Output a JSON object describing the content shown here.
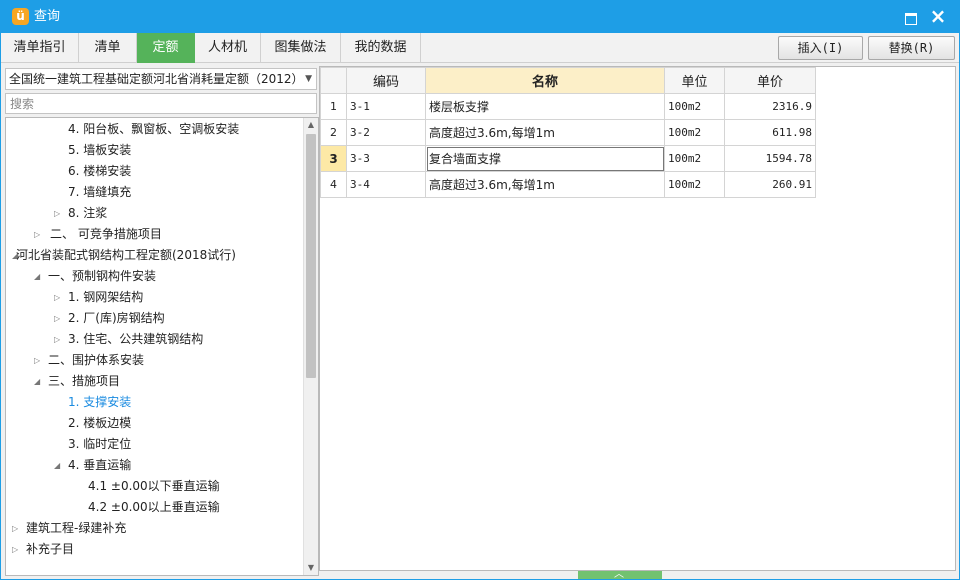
{
  "window": {
    "title": "查询",
    "app_icon": "app-logo-icon",
    "maximize_icon": "maximize-icon",
    "close_icon": "close-icon",
    "close_glyph": "×",
    "accent_color": "#1e9ee6"
  },
  "tabs": [
    {
      "label": "清单指引",
      "active": false
    },
    {
      "label": "清单",
      "active": false
    },
    {
      "label": "定额",
      "active": true
    },
    {
      "label": "人材机",
      "active": false
    },
    {
      "label": "图集做法",
      "active": false
    },
    {
      "label": "我的数据",
      "active": false
    }
  ],
  "active_tab_color": "#55b35a",
  "actions": {
    "insert_label": "插入(I)",
    "replace_label": "替换(R)"
  },
  "left": {
    "quota_library": "全国统一建筑工程基础定额河北省消耗量定额（2012）",
    "search_placeholder": "搜索",
    "tree": [
      {
        "label": "4. 阳台板、飘窗板、空调板安装",
        "toggle": ""
      },
      {
        "label": "5. 墙板安装",
        "toggle": ""
      },
      {
        "label": "6. 楼梯安装",
        "toggle": ""
      },
      {
        "label": "7. 墙缝填充",
        "toggle": ""
      },
      {
        "label": "8. 注浆",
        "toggle": "▷"
      },
      {
        "label": "二、 可竞争措施项目",
        "toggle": "▷"
      },
      {
        "label": "河北省装配式钢结构工程定额(2018试行)",
        "toggle": "◢"
      },
      {
        "label": "一、预制钢构件安装",
        "toggle": "◢"
      },
      {
        "label": "1. 钢网架结构",
        "toggle": "▷"
      },
      {
        "label": "2. 厂(库)房钢结构",
        "toggle": "▷"
      },
      {
        "label": "3. 住宅、公共建筑钢结构",
        "toggle": "▷"
      },
      {
        "label": "二、围护体系安装",
        "toggle": "▷"
      },
      {
        "label": "三、措施项目",
        "toggle": "◢"
      },
      {
        "label": "1. 支撑安装",
        "toggle": "",
        "selected": true
      },
      {
        "label": "2. 楼板边模",
        "toggle": ""
      },
      {
        "label": "3. 临时定位",
        "toggle": ""
      },
      {
        "label": "4. 垂直运输",
        "toggle": "◢"
      },
      {
        "label": "4.1 ±0.00以下垂直运输",
        "toggle": ""
      },
      {
        "label": "4.2 ±0.00以上垂直运输",
        "toggle": ""
      },
      {
        "label": "建筑工程-绿建补充",
        "toggle": "▷"
      },
      {
        "label": "补充子目",
        "toggle": "▷"
      }
    ],
    "selected_color": "#1a8be0"
  },
  "grid": {
    "columns": [
      "",
      "编码",
      "名称",
      "单位",
      "单价"
    ],
    "rows": [
      {
        "num": "1",
        "code": "3-1",
        "name": "楼层板支撑",
        "unit": "100m2",
        "price": "2316.9"
      },
      {
        "num": "2",
        "code": "3-2",
        "name": "高度超过3.6m,每增1m",
        "unit": "100m2",
        "price": "611.98"
      },
      {
        "num": "3",
        "code": "3-3",
        "name": "复合墙面支撑",
        "unit": "100m2",
        "price": "1594.78"
      },
      {
        "num": "4",
        "code": "3-4",
        "name": "高度超过3.6m,每增1m",
        "unit": "100m2",
        "price": "260.91"
      }
    ],
    "current_row": 2,
    "sorted_header_color": "#fcefc8"
  }
}
